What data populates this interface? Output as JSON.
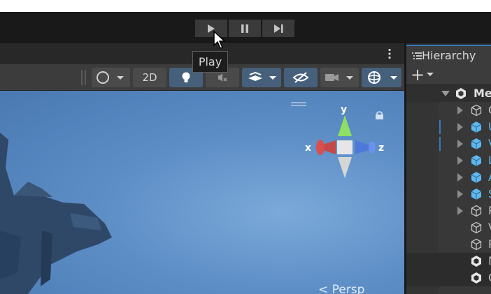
{
  "toolbar": {
    "play_icon": "play-icon",
    "pause_icon": "pause-icon",
    "step_icon": "step-icon"
  },
  "tooltip": {
    "text": "Play"
  },
  "scene_toolbar": {
    "shading_icon": "shading-mode-icon",
    "mode_2d": "2D",
    "lighting_icon": "light-bulb-icon",
    "audio_icon": "audio-mute-icon",
    "effects_icon": "effects-layers-icon",
    "visibility_icon": "hidden-eye-icon",
    "camera_icon": "camera-icon",
    "gizmos_icon": "gizmos-icon"
  },
  "gizmo": {
    "y": "y",
    "x": "x",
    "z": "z",
    "projection": "Persp"
  },
  "hierarchy": {
    "title": "Hierarchy",
    "add_label": "+",
    "root": "Me",
    "rows": [
      {
        "label": "C",
        "color": "#c4c4c4",
        "prefab": false,
        "arrow": true
      },
      {
        "label": "U",
        "color": "#5eb8f0",
        "prefab": true,
        "arrow": true
      },
      {
        "label": "V",
        "color": "#5eb8f0",
        "prefab": true,
        "arrow": true
      },
      {
        "label": "L",
        "color": "#5eb8f0",
        "prefab": true,
        "arrow": true
      },
      {
        "label": "A",
        "color": "#5eb8f0",
        "prefab": true,
        "arrow": true
      },
      {
        "label": "S",
        "color": "#5eb8f0",
        "prefab": true,
        "arrow": true
      },
      {
        "label": "P",
        "color": "#c4c4c4",
        "prefab": false,
        "arrow": true
      },
      {
        "label": "V",
        "color": "#c4c4c4",
        "prefab": false,
        "arrow": false
      },
      {
        "label": "P",
        "color": "#c4c4c4",
        "prefab": false,
        "arrow": false
      },
      {
        "label": "M",
        "color": "#c4c4c4",
        "prefab": false,
        "arrow": false
      },
      {
        "label": "C",
        "color": "#c4c4c4",
        "prefab": false,
        "arrow": false
      }
    ]
  },
  "colors": {
    "accent": "#3a79bb",
    "prefab_blue": "#5eb8f0",
    "toolbar_active": "#46607c"
  }
}
